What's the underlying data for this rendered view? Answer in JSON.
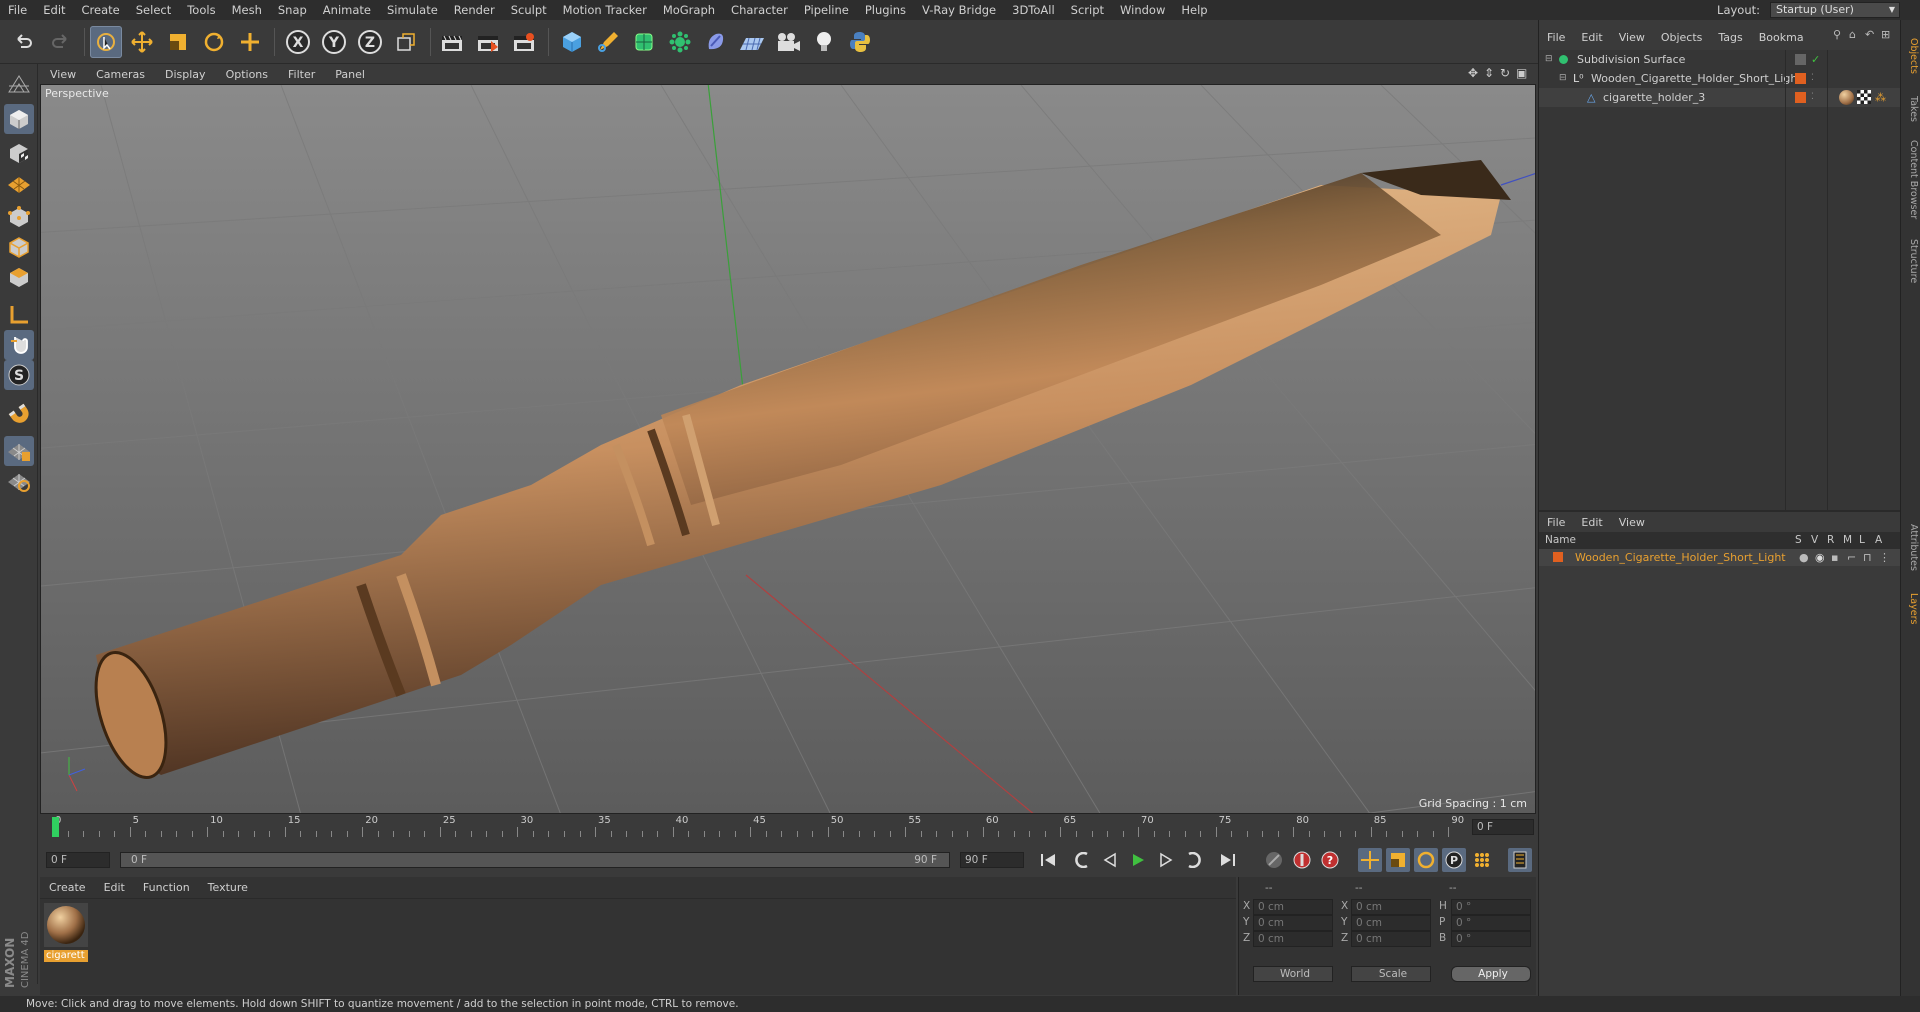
{
  "menubar": {
    "items": [
      "File",
      "Edit",
      "Create",
      "Select",
      "Tools",
      "Mesh",
      "Snap",
      "Animate",
      "Simulate",
      "Render",
      "Sculpt",
      "Motion Tracker",
      "MoGraph",
      "Character",
      "Pipeline",
      "Plugins",
      "V-Ray Bridge",
      "3DToAll",
      "Script",
      "Window",
      "Help"
    ],
    "layout_label": "Layout:",
    "layout_value": "Startup (User)"
  },
  "toolbar": {
    "icons": [
      "undo-icon",
      "redo-icon",
      "live-selection-icon",
      "move-icon",
      "scale-icon",
      "rotate-icon",
      "add-object-icon",
      "x-axis-lock-icon",
      "y-axis-lock-icon",
      "z-axis-lock-icon",
      "coordinate-system-icon",
      "render-view-icon",
      "render-picture-viewer-icon",
      "edit-render-settings-icon",
      "cube-icon",
      "pen-icon",
      "subdivision-icon",
      "mograph-cloner-icon",
      "deformer-icon",
      "floor-icon",
      "camera-icon",
      "light-icon",
      "python-icon"
    ],
    "axis_labels": [
      "X",
      "Y",
      "Z"
    ]
  },
  "lefttools": {
    "icons": [
      "make-editable-icon",
      "model-mode-icon",
      "texture-mode-icon",
      "workplane-icon",
      "points-mode-icon",
      "edges-mode-icon",
      "polygons-mode-icon",
      "enable-axis-icon",
      "tweak-mode-icon",
      "solo-icon",
      "snap-icon",
      "quantize-icon",
      "locked-workplane-icon"
    ],
    "solo_label": "S"
  },
  "viewport": {
    "menu": [
      "View",
      "Cameras",
      "Display",
      "Options",
      "Filter",
      "Panel"
    ],
    "label": "Perspective",
    "grid_spacing": "Grid Spacing : 1 cm"
  },
  "timeline": {
    "ticks": [
      "0",
      "5",
      "10",
      "15",
      "20",
      "25",
      "30",
      "35",
      "40",
      "45",
      "50",
      "55",
      "60",
      "65",
      "70",
      "75",
      "80",
      "85",
      "90"
    ],
    "current_frame_right": "0 F"
  },
  "playbar": {
    "start_frame": "0 F",
    "range_start": "0 F",
    "range_end": "90 F",
    "end_frame": "90 F",
    "p_label": "P"
  },
  "materials": {
    "menu": [
      "Create",
      "Edit",
      "Function",
      "Texture"
    ],
    "items": [
      {
        "name": "cigarett"
      }
    ]
  },
  "coords": {
    "header": [
      "--",
      "--",
      "--"
    ],
    "rows": [
      {
        "a": "X",
        "av": "0 cm",
        "b": "X",
        "bv": "0 cm",
        "c": "H",
        "cv": "0 °"
      },
      {
        "a": "Y",
        "av": "0 cm",
        "b": "Y",
        "bv": "0 cm",
        "c": "P",
        "cv": "0 °"
      },
      {
        "a": "Z",
        "av": "0 cm",
        "b": "Z",
        "bv": "0 cm",
        "c": "B",
        "cv": "0 °"
      }
    ],
    "world": "World",
    "scale": "Scale",
    "apply": "Apply"
  },
  "objects": {
    "menu": [
      "File",
      "Edit",
      "View",
      "Objects",
      "Tags",
      "Bookma"
    ],
    "rows": [
      {
        "name": "Subdivision Surface"
      },
      {
        "name": "Wooden_Cigarette_Holder_Short_Light"
      },
      {
        "name": "cigarette_holder_3"
      }
    ]
  },
  "layers": {
    "menu": [
      "File",
      "Edit",
      "View"
    ],
    "header_name": "Name",
    "header_cols": [
      "S",
      "V",
      "R",
      "M",
      "L",
      "A"
    ],
    "row_name": "Wooden_Cigarette_Holder_Short_Light"
  },
  "sidetabs": [
    "Objects",
    "Takes",
    "Content Browser",
    "Structure",
    "Attributes",
    "Layers"
  ],
  "branding": {
    "maxon": "MAXON",
    "product": "CINEMA 4D"
  },
  "status": "Move: Click and drag to move elements. Hold down SHIFT to quantize movement / add to the selection in point mode, CTRL to remove.",
  "colors": {
    "accent": "#e8a030",
    "selected_tool": "#5a6a80",
    "wood": "#c89060"
  }
}
